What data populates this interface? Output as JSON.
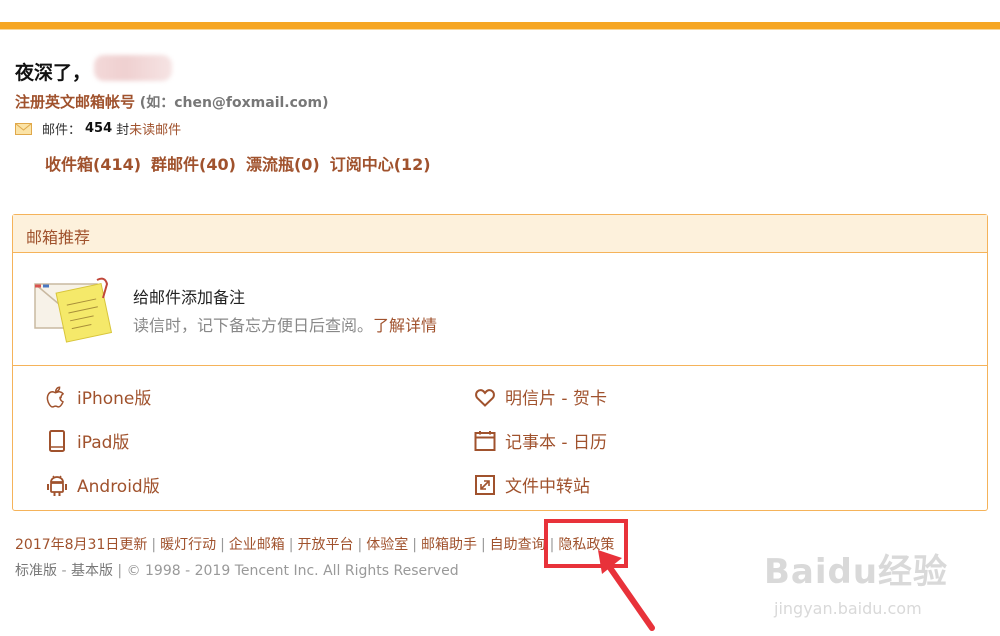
{
  "greeting": "夜深了，",
  "register": {
    "link": "注册英文邮箱帐号",
    "hint": "(如：chen@foxmail.com)"
  },
  "mail": {
    "label": "邮件：",
    "count": "454",
    "unit": "封",
    "unread": "未读邮件"
  },
  "folders": [
    {
      "label": "收件箱(414)"
    },
    {
      "label": "群邮件(40)"
    },
    {
      "label": "漂流瓶(0)"
    },
    {
      "label": "订阅中心(12)"
    }
  ],
  "panel": {
    "title": "邮箱推荐",
    "recommend": {
      "title": "给邮件添加备注",
      "desc": "读信时，记下备忘方便日后查阅。",
      "more": "了解详情"
    },
    "apps": [
      {
        "label": "iPhone版",
        "icon": "apple-icon"
      },
      {
        "label": "iPad版",
        "icon": "tablet-icon"
      },
      {
        "label": "Android版",
        "icon": "android-icon"
      },
      {
        "label": "明信片 - 贺卡",
        "icon": "heart-icon"
      },
      {
        "label": "记事本 - 日历",
        "icon": "calendar-icon"
      },
      {
        "label": "文件中转站",
        "icon": "file-transfer-icon"
      }
    ]
  },
  "footer": {
    "links": [
      "2017年8月31日更新",
      "暖灯行动",
      "企业邮箱",
      "开放平台",
      "体验室",
      "邮箱助手",
      "自助查询",
      "隐私政策"
    ],
    "standard": "标准版",
    "dash": " - ",
    "basic": "基本版",
    "copyright": "© 1998 - 2019 Tencent Inc. All Rights Reserved"
  },
  "watermark": {
    "logo": "Baidu经验",
    "url": "jingyan.baidu.com"
  },
  "colors": {
    "accent": "#f6a623",
    "link": "#a0522d",
    "highlight": "#e8323a"
  }
}
